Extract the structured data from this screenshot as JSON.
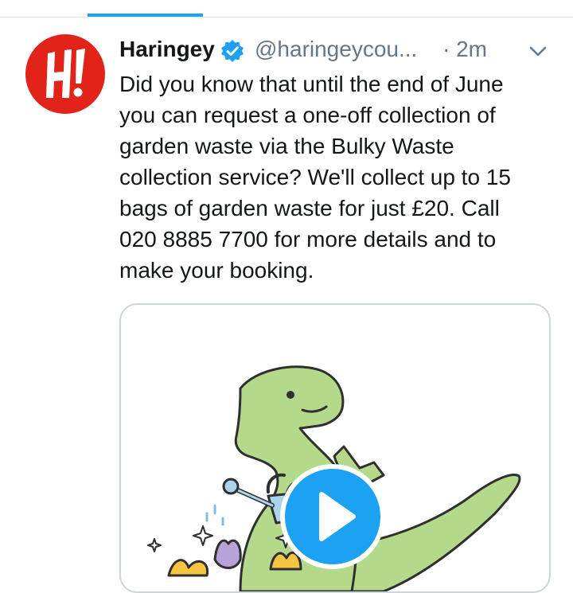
{
  "tweet": {
    "author_name": "Haringey",
    "handle": "@haringeycou...",
    "time": "· 2m",
    "verified_icon": "verified-badge-icon",
    "menu_icon": "chevron-down-icon",
    "avatar_text": "H!",
    "text_lines": [
      "Did you know that until the end of June",
      "you can request a one-off collection of",
      "garden waste via the Bulky Waste",
      "collection service? We'll collect up to 15",
      "bags of garden waste for just £20. Call",
      "020 8885 7700 for more details and to",
      "make your booking."
    ],
    "media_icon": "play-video-icon"
  },
  "colors": {
    "accent": "#1da1f2",
    "avatar_red": "#e2231a",
    "secondary_text": "#657786",
    "dino_green": "#b5d98a"
  }
}
